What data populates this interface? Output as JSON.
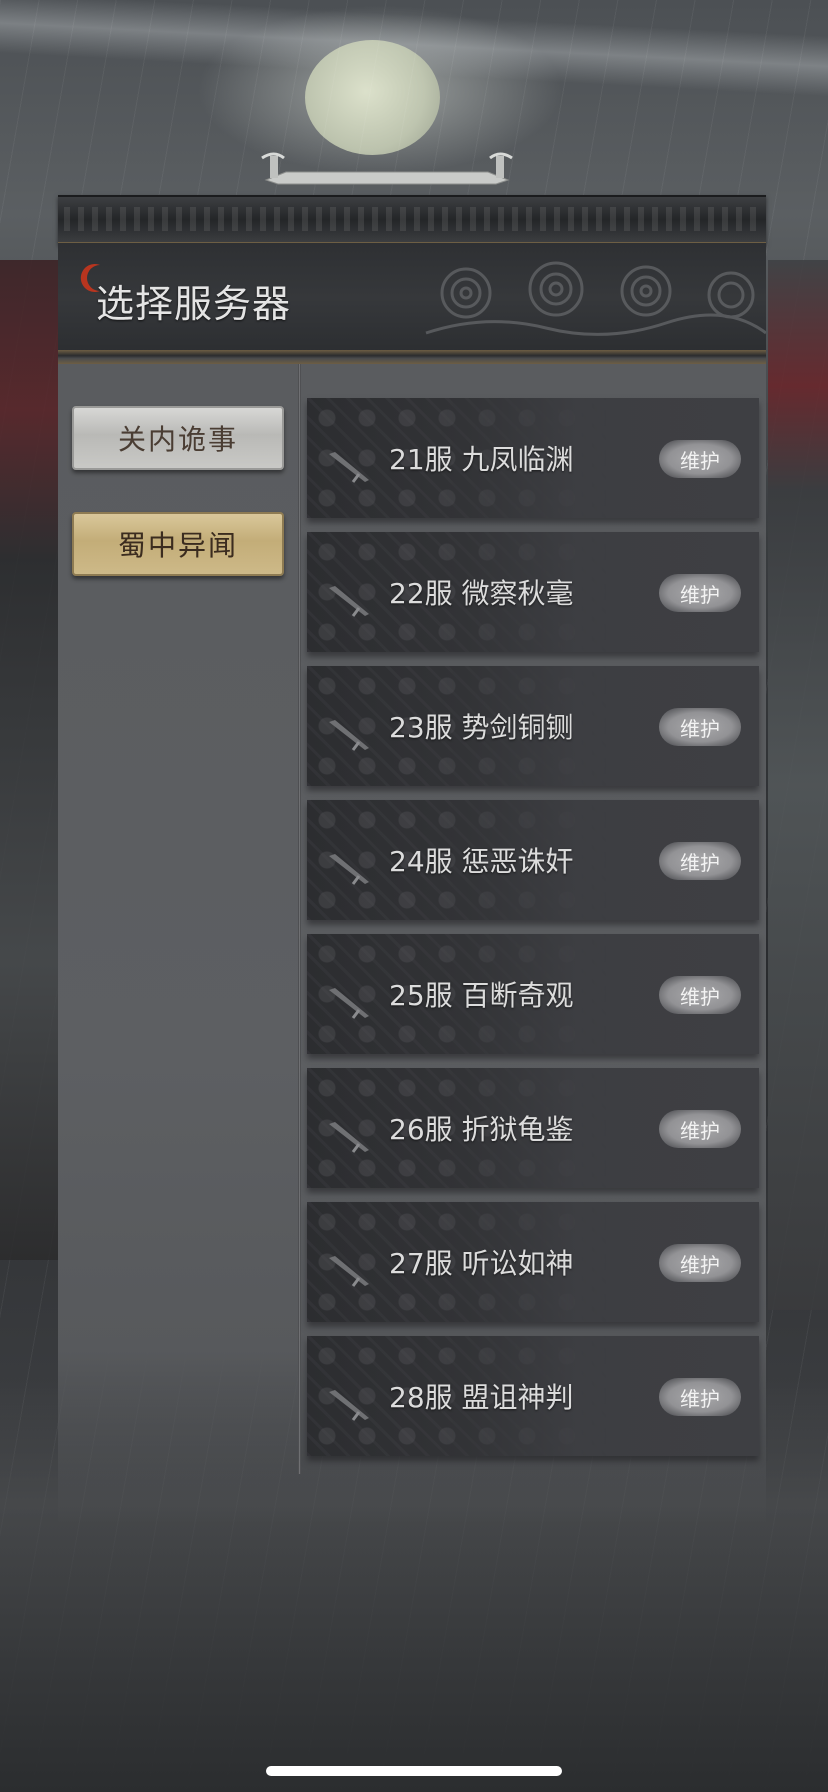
{
  "header": {
    "title": "选择服务器"
  },
  "categories": [
    {
      "label": "关内诡事",
      "selected": false
    },
    {
      "label": "蜀中异闻",
      "selected": true
    }
  ],
  "servers": [
    {
      "name": "21服 九凤临渊",
      "status": "维护"
    },
    {
      "name": "22服 微察秋毫",
      "status": "维护"
    },
    {
      "name": "23服 势剑铜铡",
      "status": "维护"
    },
    {
      "name": "24服 惩恶诛奸",
      "status": "维护"
    },
    {
      "name": "25服 百断奇观",
      "status": "维护"
    },
    {
      "name": "26服 折狱龟鉴",
      "status": "维护"
    },
    {
      "name": "27服 听讼如神",
      "status": "维护"
    },
    {
      "name": "28服 盟诅神判",
      "status": "维护"
    }
  ],
  "colors": {
    "selected_category": "#c3ad78",
    "unselected_category": "#b9b9b6",
    "status_badge": "#929295",
    "title_accent": "#b8351f"
  },
  "icons": {
    "title_mark": "red-crescent-icon",
    "row_icon": "sword-icon"
  }
}
